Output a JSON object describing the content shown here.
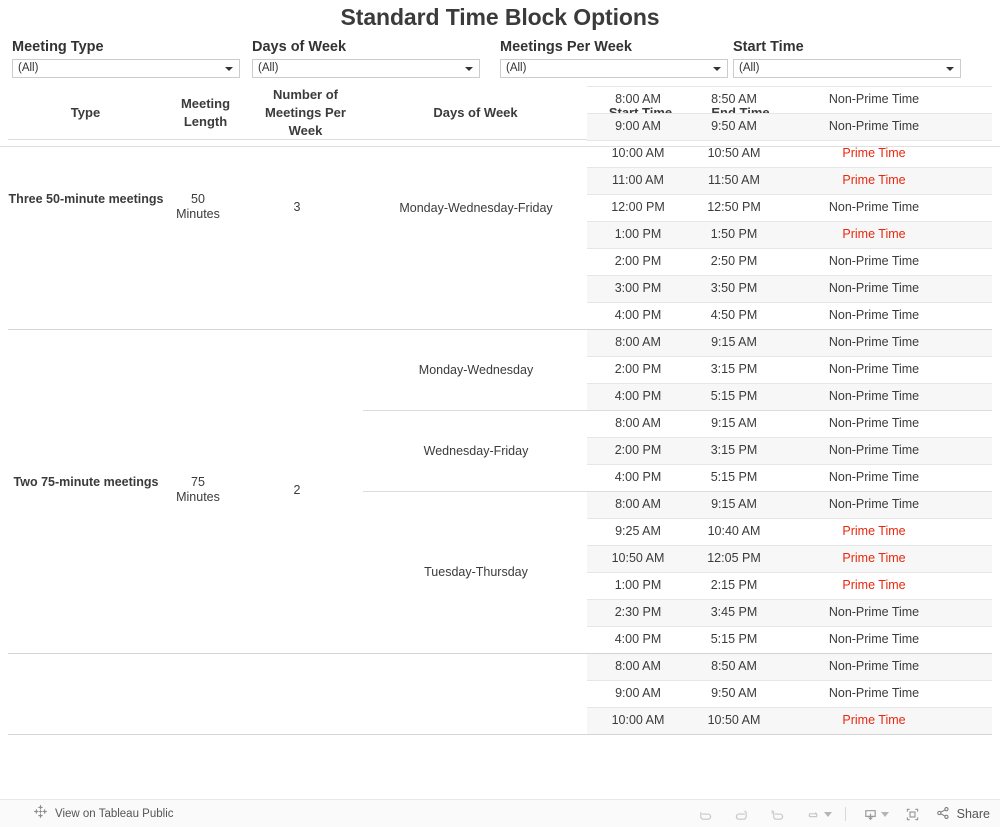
{
  "title": "Standard Time Block Options",
  "filters": [
    {
      "label": "Meeting Type",
      "value": "(All)"
    },
    {
      "label": "Days of Week",
      "value": "(All)"
    },
    {
      "label": "Meetings Per Week",
      "value": "(All)"
    },
    {
      "label": "Start Time",
      "value": "(All)"
    }
  ],
  "columns": [
    "Type",
    "Meeting Length",
    "Number of Meetings Per Week",
    "Days of Week",
    "Start Time",
    "End Time",
    ""
  ],
  "colors": {
    "prime": "#e8280f",
    "text": "#3b3b3b",
    "band": "#f7f7f7"
  },
  "groups": [
    {
      "type": "Three 50-minute meetings",
      "length": "50 Minutes",
      "per_week": "3",
      "day_blocks": [
        {
          "days": "Monday-Wednesday-Friday",
          "rows": [
            {
              "start": "8:00 AM",
              "end": "8:50 AM",
              "prime": "Non-Prime Time"
            },
            {
              "start": "9:00 AM",
              "end": "9:50 AM",
              "prime": "Non-Prime Time"
            },
            {
              "start": "10:00 AM",
              "end": "10:50 AM",
              "prime": "Prime Time"
            },
            {
              "start": "11:00 AM",
              "end": "11:50 AM",
              "prime": "Prime Time"
            },
            {
              "start": "12:00 PM",
              "end": "12:50 PM",
              "prime": "Non-Prime Time"
            },
            {
              "start": "1:00 PM",
              "end": "1:50 PM",
              "prime": "Prime Time"
            },
            {
              "start": "2:00 PM",
              "end": "2:50 PM",
              "prime": "Non-Prime Time"
            },
            {
              "start": "3:00 PM",
              "end": "3:50 PM",
              "prime": "Non-Prime Time"
            },
            {
              "start": "4:00 PM",
              "end": "4:50 PM",
              "prime": "Non-Prime Time"
            }
          ]
        }
      ]
    },
    {
      "type": "Two 75-minute meetings",
      "length": "75 Minutes",
      "per_week": "2",
      "day_blocks": [
        {
          "days": "Monday-Wednesday",
          "rows": [
            {
              "start": "8:00 AM",
              "end": "9:15 AM",
              "prime": "Non-Prime Time"
            },
            {
              "start": "2:00 PM",
              "end": "3:15 PM",
              "prime": "Non-Prime Time"
            },
            {
              "start": "4:00 PM",
              "end": "5:15 PM",
              "prime": "Non-Prime Time"
            }
          ]
        },
        {
          "days": "Wednesday-Friday",
          "rows": [
            {
              "start": "8:00 AM",
              "end": "9:15 AM",
              "prime": "Non-Prime Time"
            },
            {
              "start": "2:00 PM",
              "end": "3:15 PM",
              "prime": "Non-Prime Time"
            },
            {
              "start": "4:00 PM",
              "end": "5:15 PM",
              "prime": "Non-Prime Time"
            }
          ]
        },
        {
          "days": "Tuesday-Thursday",
          "rows": [
            {
              "start": "8:00 AM",
              "end": "9:15 AM",
              "prime": "Non-Prime Time"
            },
            {
              "start": "9:25 AM",
              "end": "10:40 AM",
              "prime": "Prime Time"
            },
            {
              "start": "10:50 AM",
              "end": "12:05 PM",
              "prime": "Prime Time"
            },
            {
              "start": "1:00 PM",
              "end": "2:15 PM",
              "prime": "Prime Time"
            },
            {
              "start": "2:30 PM",
              "end": "3:45 PM",
              "prime": "Non-Prime Time"
            },
            {
              "start": "4:00 PM",
              "end": "5:15 PM",
              "prime": "Non-Prime Time"
            }
          ]
        }
      ]
    },
    {
      "type": "",
      "length": "",
      "per_week": "",
      "day_blocks": [
        {
          "days": "",
          "rows": [
            {
              "start": "8:00 AM",
              "end": "8:50 AM",
              "prime": "Non-Prime Time"
            },
            {
              "start": "9:00 AM",
              "end": "9:50 AM",
              "prime": "Non-Prime Time"
            },
            {
              "start": "10:00 AM",
              "end": "10:50 AM",
              "prime": "Prime Time"
            }
          ]
        }
      ]
    }
  ],
  "toolbar": {
    "view_label": "View on Tableau Public",
    "share_label": "Share",
    "buttons": [
      "undo",
      "redo",
      "revert",
      "refresh",
      "download",
      "fullscreen",
      "share"
    ]
  }
}
